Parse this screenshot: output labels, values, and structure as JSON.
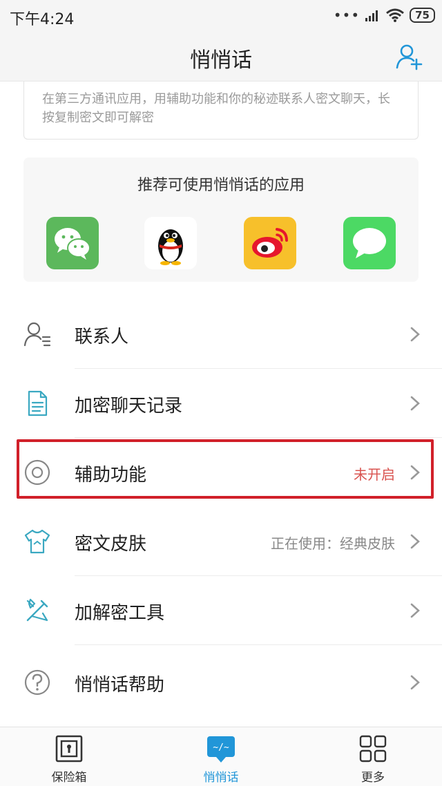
{
  "status_bar": {
    "time": "下午4:24",
    "signal_dots": "•••",
    "battery": "75"
  },
  "header": {
    "title": "悄悄话",
    "add_contact_icon": "add-user-icon"
  },
  "info": {
    "text": "在第三方通讯应用，用辅助功能和你的秘迹联系人密文聊天，长按复制密文即可解密"
  },
  "recommend": {
    "title": "推荐可使用悄悄话的应用",
    "apps": [
      {
        "name": "wechat-icon",
        "color": "#5cb85c"
      },
      {
        "name": "qq-penguin-icon",
        "color": "#ffffff"
      },
      {
        "name": "weibo-icon",
        "color": "#f7c02b"
      },
      {
        "name": "messages-icon",
        "color": "#4cd964"
      }
    ]
  },
  "menu": [
    {
      "label": "联系人",
      "value": "",
      "icon": "contacts-icon"
    },
    {
      "label": "加密聊天记录",
      "value": "",
      "icon": "document-icon"
    },
    {
      "label": "辅助功能",
      "value": "未开启",
      "icon": "accessibility-icon"
    },
    {
      "label": "密文皮肤",
      "value": "正在使用：经典皮肤",
      "icon": "tshirt-icon"
    },
    {
      "label": "加解密工具",
      "value": "",
      "icon": "tools-icon"
    },
    {
      "label": "悄悄话帮助",
      "value": "",
      "icon": "help-icon"
    }
  ],
  "tabs": [
    {
      "label": "保险箱",
      "icon": "safe-icon"
    },
    {
      "label": "悄悄话",
      "icon": "chat-bubble-icon",
      "active": true
    },
    {
      "label": "更多",
      "icon": "grid-icon"
    }
  ],
  "colors": {
    "accent": "#2196d8",
    "alert": "#d9534f",
    "highlight_border": "#d1202a",
    "icon_teal": "#3aa8c1"
  }
}
